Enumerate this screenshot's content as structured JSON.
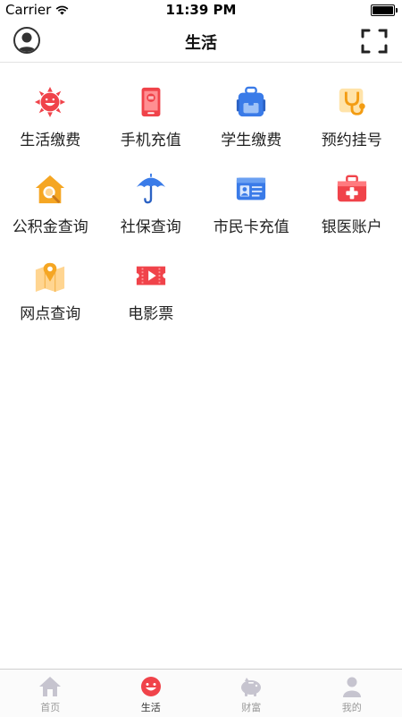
{
  "status_bar": {
    "carrier": "Carrier",
    "time": "11:39 PM"
  },
  "nav": {
    "title": "生活",
    "left_icon": "avatar-icon",
    "right_icon": "scan-icon"
  },
  "services": [
    {
      "label": "生活缴费",
      "icon": "sun-bill-icon"
    },
    {
      "label": "手机充值",
      "icon": "phone-icon"
    },
    {
      "label": "学生缴费",
      "icon": "backpack-icon"
    },
    {
      "label": "预约挂号",
      "icon": "stethoscope-icon"
    },
    {
      "label": "公积金查询",
      "icon": "house-search-icon"
    },
    {
      "label": "社保查询",
      "icon": "umbrella-icon"
    },
    {
      "label": "市民卡充值",
      "icon": "id-card-icon"
    },
    {
      "label": "银医账户",
      "icon": "medical-kit-icon"
    },
    {
      "label": "网点查询",
      "icon": "map-pin-icon"
    },
    {
      "label": "电影票",
      "icon": "ticket-icon"
    }
  ],
  "tabs": [
    {
      "label": "首页",
      "icon": "home-icon",
      "active": false
    },
    {
      "label": "生活",
      "icon": "life-smiley-icon",
      "active": true
    },
    {
      "label": "财富",
      "icon": "piggy-bank-icon",
      "active": false
    },
    {
      "label": "我的",
      "icon": "user-icon",
      "active": false
    }
  ],
  "colors": {
    "accent_red": "#f0434a",
    "tab_inactive": "#c6c4cf"
  }
}
